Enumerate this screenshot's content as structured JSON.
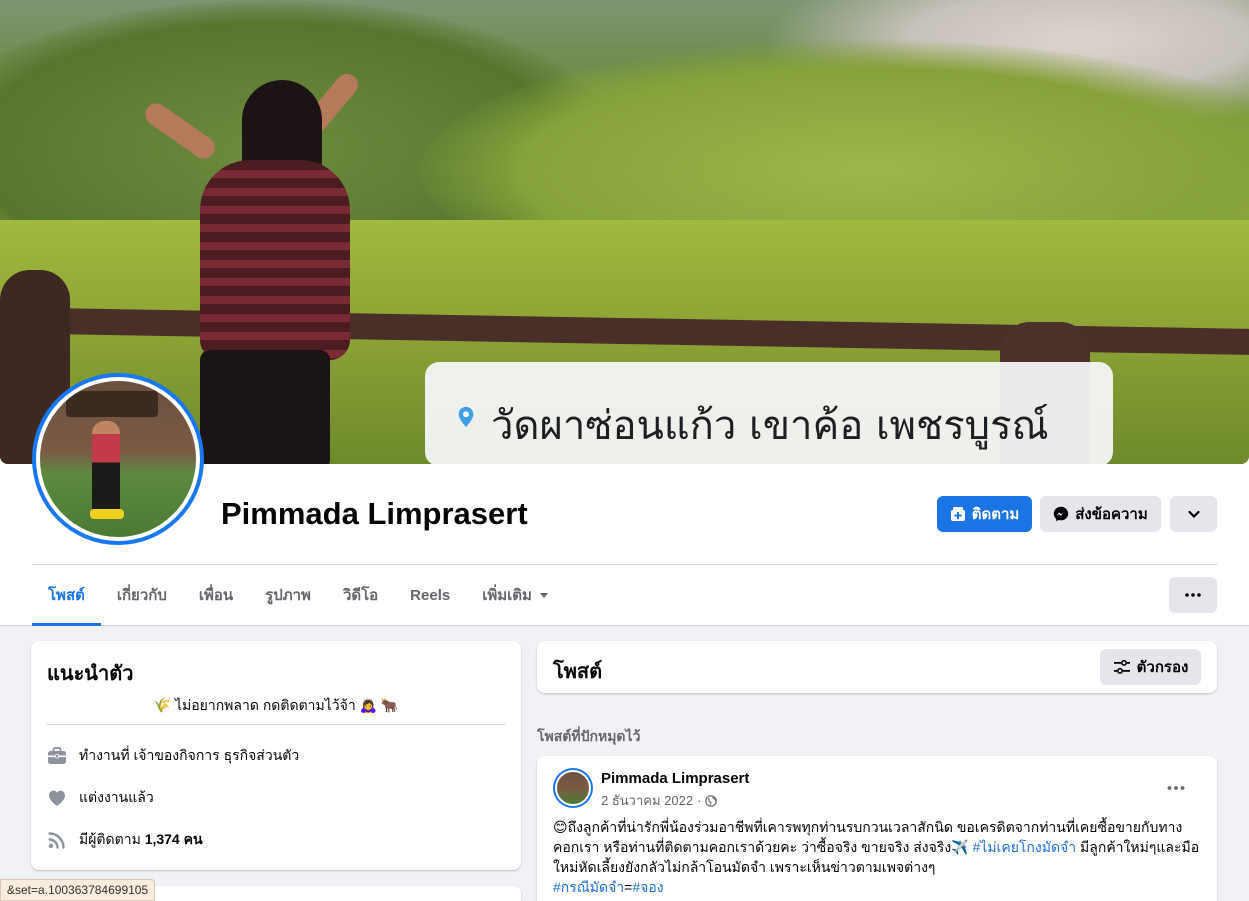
{
  "cover": {
    "location_text": "วัดผาซ่อนแก้ว เขาค้อ เพชรบูรณ์",
    "pin_color": "#3fa0e8"
  },
  "profile": {
    "name": "Pimmada Limprasert"
  },
  "actions": {
    "follow_label": "ติดตาม",
    "message_label": "ส่งข้อความ"
  },
  "tabs": [
    {
      "label": "โพสต์",
      "active": true
    },
    {
      "label": "เกี่ยวกับ"
    },
    {
      "label": "เพื่อน"
    },
    {
      "label": "รูปภาพ"
    },
    {
      "label": "วิดีโอ"
    },
    {
      "label": "Reels"
    },
    {
      "label": "เพิ่มเติม"
    }
  ],
  "intro": {
    "title": "แนะนำตัว",
    "bio": "🌾 ไม่อยากพลาด กดติดตามไว้จ้า 🙇‍♀️ 🐂",
    "work": "ทำงานที่ เจ้าของกิจการ ธุรกิจส่วนตัว",
    "relationship": "แต่งงานแล้ว",
    "followers_prefix": "มีผู้ติดตาม",
    "followers_count": "1,374 คน"
  },
  "posts": {
    "title": "โพสต์",
    "filter_label": "ตัวกรอง",
    "pinned_label": "โพสต์ที่ปักหมุดไว้",
    "pinned_post": {
      "author": "Pimmada Limprasert",
      "date": "2 ธันวาคม 2022",
      "text_1": "😊ถึงลูกค้าที่น่ารักพี่น้องร่วมอาชีพที่เคารพทุกท่านรบกวนเวลาสักนิด ขอเครดิตจากท่านที่เคยซื้อขายกับทางคอกเรา หรือท่านที่ติดตามคอกเราด้วยคะ ว่าซื้อจริง ขายจริง ส่งจริง✈️ ",
      "tag_1": "#ไม่เคยโกงมัดจำ",
      "text_2": " มีลูกค้าใหม่ๆและมือใหม่หัดเลี้ยงยังกลัวไม่กล้าโอนมัดจำ เพราะเห็นข่าวตามเพจต่างๆ",
      "tag_2": "#กรณีมัดจำ",
      "text_3": "=",
      "tag_3": "#จอง"
    }
  },
  "status_bar": {
    "url": "&set=a.100363784699105"
  },
  "colors": {
    "accent": "#1b74e4",
    "link": "#216fdb",
    "background": "#f0f2f5"
  }
}
